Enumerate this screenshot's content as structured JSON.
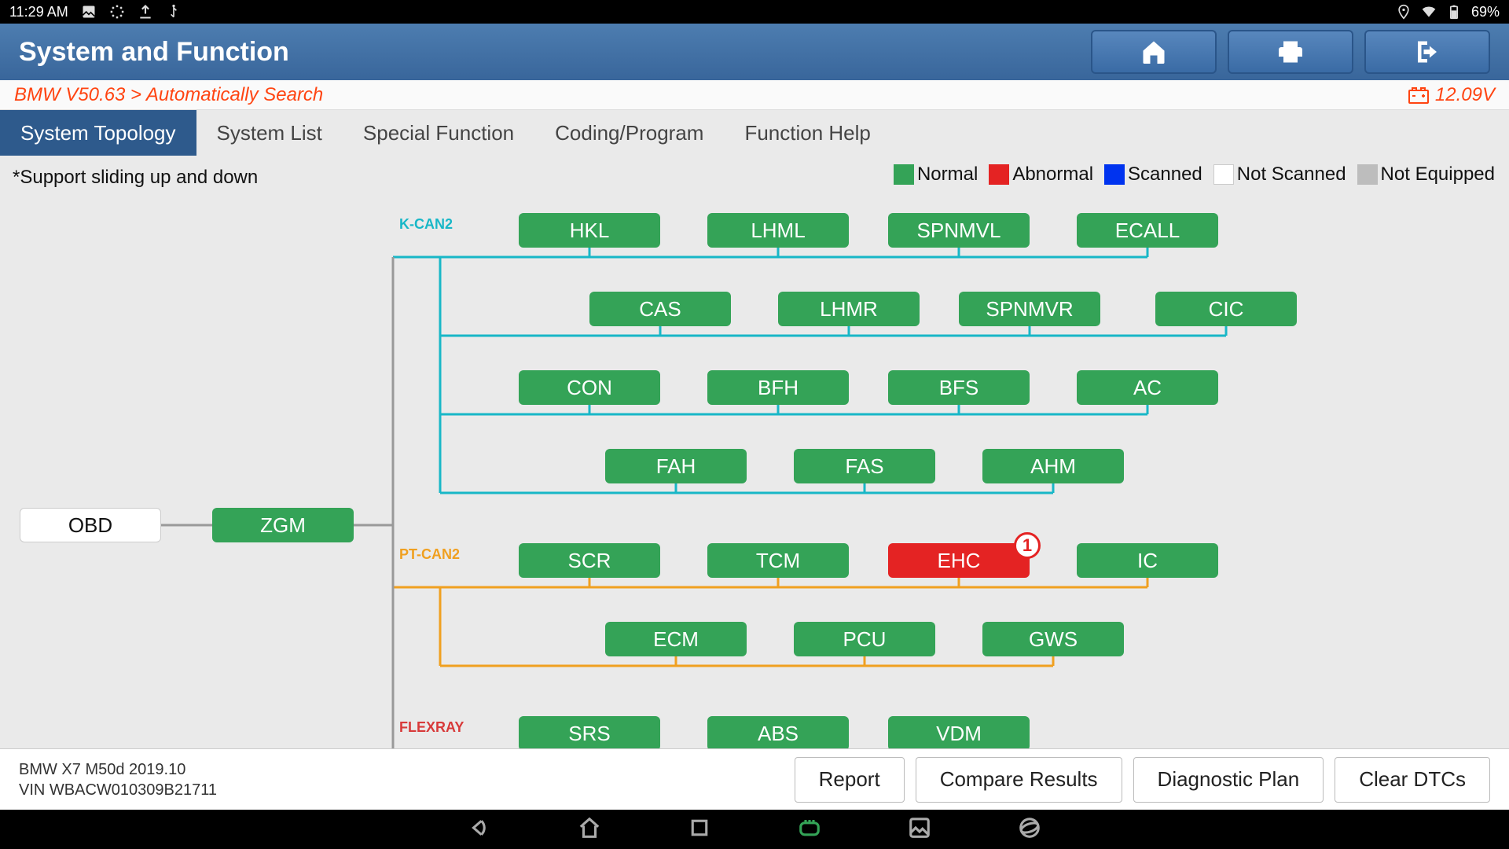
{
  "status": {
    "time": "11:29 AM",
    "battery": "69%"
  },
  "title": "System and Function",
  "breadcrumb": "BMW V50.63 > Automatically Search",
  "voltage": "12.09V",
  "tabs": [
    "System Topology",
    "System List",
    "Special Function",
    "Coding/Program",
    "Function Help"
  ],
  "active_tab": 0,
  "hint": "*Support sliding up and down",
  "legend": [
    {
      "label": "Normal",
      "color": "#34a357"
    },
    {
      "label": "Abnormal",
      "color": "#e42323"
    },
    {
      "label": "Scanned",
      "color": "#0033ef"
    },
    {
      "label": "Not Scanned",
      "color": "#ffffff"
    },
    {
      "label": "Not Equipped",
      "color": "#bdbdbd"
    }
  ],
  "root": {
    "label": "OBD",
    "status": "white"
  },
  "gateway": {
    "label": "ZGM",
    "status": "normal"
  },
  "buses": [
    {
      "name": "K-CAN2",
      "color": "#18b7c7",
      "rows": [
        [
          "HKL",
          "LHML",
          "SPNMVL",
          "ECALL"
        ],
        [
          "CAS",
          "LHMR",
          "SPNMVR",
          "CIC"
        ],
        [
          "CON",
          "BFH",
          "BFS",
          "AC"
        ],
        [
          "FAH",
          "FAS",
          "AHM"
        ]
      ]
    },
    {
      "name": "PT-CAN2",
      "color": "#f0a020",
      "rows": [
        [
          "SCR",
          "TCM",
          {
            "label": "EHC",
            "status": "abnormal",
            "badge": "1"
          },
          "IC"
        ],
        [
          "ECM",
          "PCU",
          "GWS"
        ]
      ]
    },
    {
      "name": "FLEXRAY",
      "color": "#d83a3a",
      "rows": [
        [
          "SRS",
          "ABS",
          "VDM"
        ]
      ]
    }
  ],
  "vehicle": {
    "model": "BMW X7 M50d 2019.10",
    "vin": "VIN WBACW010309B21711"
  },
  "footer_buttons": [
    "Report",
    "Compare Results",
    "Diagnostic Plan",
    "Clear DTCs"
  ]
}
